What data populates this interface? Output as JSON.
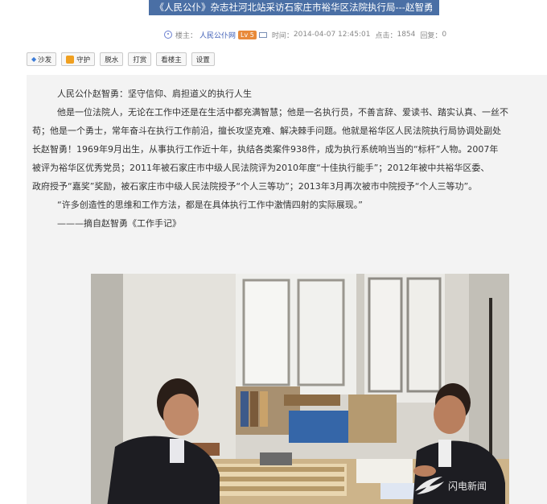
{
  "header": {
    "title": "《人民公仆》杂志社河北站采访石家庄市裕华区法院执行局---赵智勇"
  },
  "meta": {
    "author_label": "楼主：",
    "author": "人民公仆网",
    "level": "Lv 5",
    "time_label": "时间：",
    "time": "2014-04-07 12:45:01",
    "clicks_label": "点击：",
    "clicks": "1854",
    "replies_label": "回复：",
    "replies": "0"
  },
  "toolbar": {
    "buttons": [
      "沙发",
      "守护",
      "脱水",
      "打赏",
      "看楼主",
      "设置"
    ]
  },
  "post": {
    "lines": [
      "人民公仆赵智勇：坚守信仰、肩担道义的执行人生",
      "他是一位法院人，无论在工作中还是在生活中都充满智慧；他是一名执行员，不善言辞、爱读书、踏实认真、一丝不",
      "苟；他是一个勇士，常年奋斗在执行工作前沿，擅长攻坚克难、解决棘手问题。他就是裕华区人民法院执行局协调处副处",
      "长赵智勇！1969年9月出生，从事执行工作近十年，执结各类案件938件，成为执行系统响当当的“标杆”人物。2007年",
      "被评为裕华区优秀党员；2011年被石家庄市中级人民法院评为2010年度“十佳执行能手”；2012年被中共裕华区委、",
      "政府授予“嘉奖”奖励，被石家庄市中级人民法院授予“个人三等功”；2013年3月再次被市中院授予“个人三等功”。",
      "“许多创造性的思维和工作方法，都是在具体执行工作中激情四射的实际展现。”",
      "———摘自赵智勇《工作手记》"
    ]
  },
  "photo": {
    "watermark": "闪电新闻"
  },
  "colors": {
    "title_bg": "#4a6fa5",
    "content_bg": "#f3f3f3",
    "link": "#3b5bb5",
    "level_badge": "#e88a3a"
  }
}
